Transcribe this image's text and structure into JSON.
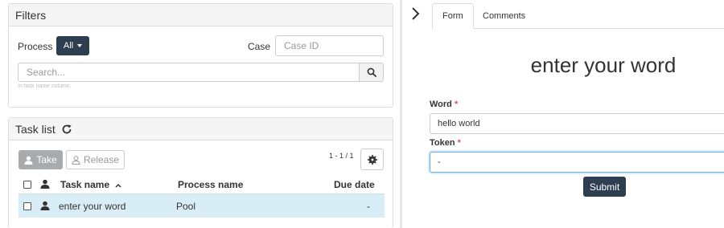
{
  "filters": {
    "title": "Filters",
    "process_label": "Process",
    "process_value": "All",
    "case_label": "Case",
    "case_placeholder": "Case ID",
    "search_placeholder": "Search...",
    "search_hint": "In task name column."
  },
  "task_list": {
    "title": "Task list",
    "take_label": "Take",
    "release_label": "Release",
    "pager": "1 - 1 / 1",
    "columns": {
      "name": "Task name",
      "process": "Process name",
      "due": "Due date"
    },
    "rows": [
      {
        "name": "enter your word",
        "process": "Pool",
        "due": "-"
      }
    ]
  },
  "form_panel": {
    "tabs": [
      "Form",
      "Comments"
    ],
    "title": "enter your word",
    "word_label": "Word",
    "word_value": "hello world",
    "token_label": "Token",
    "token_value": "-",
    "required_mark": "*",
    "submit_label": "Submit"
  },
  "icons": {
    "collapse": "chevron-right-icon",
    "refresh": "refresh-icon",
    "search": "search-icon",
    "gear": "gear-icon",
    "user": "user-icon",
    "sort": "sort-up-icon"
  },
  "colors": {
    "primary_dark": "#2c3e50",
    "selected_row": "#d9edf7",
    "required": "#d9534f",
    "focus": "#66afe9"
  }
}
